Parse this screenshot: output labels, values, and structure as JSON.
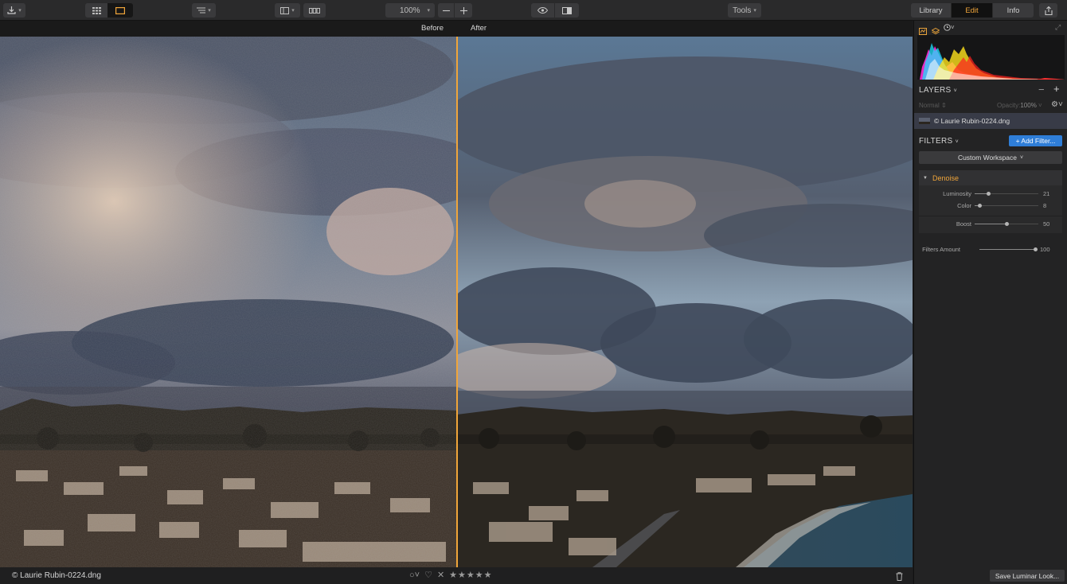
{
  "toolbar": {
    "zoom_value": "100%",
    "tools_label": "Tools",
    "tabs": [
      {
        "label": "Library",
        "active": false
      },
      {
        "label": "Edit",
        "active": true
      },
      {
        "label": "Info",
        "active": false
      }
    ]
  },
  "compare": {
    "before_label": "Before",
    "after_label": "After"
  },
  "bottom": {
    "filename": "© Laurie Rubin-0224.dng",
    "stars": "★★★★★",
    "reject_icon": "x-icon",
    "flag_icon": "heart-icon"
  },
  "panel": {
    "layers_title": "LAYERS",
    "blend_mode": "Normal",
    "opacity_label": "Opacity:",
    "opacity_value": "100%",
    "layer_name": "© Laurie Rubin-0224.dng",
    "filters_title": "FILTERS",
    "add_filter_label": "+ Add Filter...",
    "workspace_label": "Custom Workspace",
    "denoise": {
      "title": "Denoise",
      "sliders": [
        {
          "label": "Luminosity",
          "value": "21",
          "pos": 0.21
        },
        {
          "label": "Color",
          "value": "8",
          "pos": 0.08
        },
        {
          "label": "Boost",
          "value": "50",
          "pos": 0.5
        }
      ]
    },
    "filters_amount": {
      "label": "Filters Amount",
      "value": "100",
      "pos": 1.0
    },
    "save_look_label": "Save Luminar Look..."
  },
  "colors": {
    "accent": "#f0a53a",
    "button_blue": "#2f7ed8"
  }
}
